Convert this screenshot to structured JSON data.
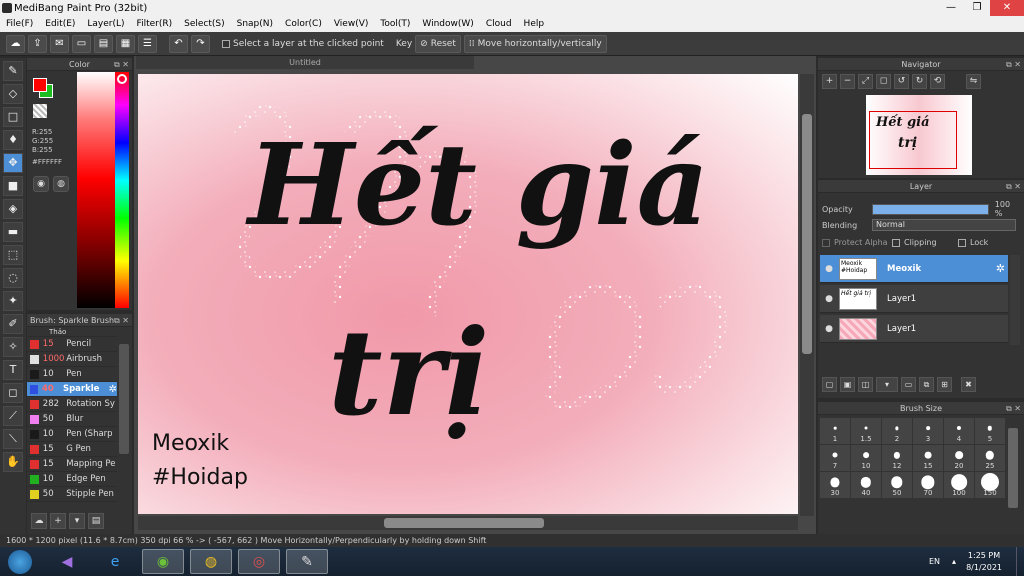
{
  "window": {
    "title": "MediBang Paint Pro (32bit)",
    "controls": [
      "—",
      "❐",
      "✕"
    ]
  },
  "menu": [
    "File(F)",
    "Edit(E)",
    "Layer(L)",
    "Filter(R)",
    "Select(S)",
    "Snap(N)",
    "Color(C)",
    "View(V)",
    "Tool(T)",
    "Window(W)",
    "Cloud",
    "Help"
  ],
  "toolbar": {
    "select_layer_label": "Select a layer at the clicked point",
    "key_label": "Key",
    "reset_label": "Reset",
    "move_label": "Move horizontally/vertically"
  },
  "color_panel": {
    "title": "Color",
    "r": "R:255",
    "g": "G:255",
    "b": "B:255",
    "hex": "#FFFFFF"
  },
  "brush_panel": {
    "title": "Brush: Sparkle Brush",
    "partial_top": "Thảo",
    "items": [
      {
        "size": "15",
        "name": "Pencil",
        "color": "#e03030",
        "red_size": true
      },
      {
        "size": "1000",
        "name": "Airbrush",
        "color": "#e0e0e0",
        "red_size": true
      },
      {
        "size": "10",
        "name": "Pen",
        "color": "#1a1a1a",
        "red_size": false
      },
      {
        "size": "40",
        "name": "Sparkle",
        "color": "#2f4fe0",
        "red_size": true,
        "selected": true
      },
      {
        "size": "282",
        "name": "Rotation Sy",
        "color": "#e03030",
        "red_size": false
      },
      {
        "size": "50",
        "name": "Blur",
        "color": "#f080f0",
        "red_size": false
      },
      {
        "size": "10",
        "name": "Pen (Sharp",
        "color": "#1a1a1a",
        "red_size": false
      },
      {
        "size": "15",
        "name": "G Pen",
        "color": "#e03030",
        "red_size": false
      },
      {
        "size": "15",
        "name": "Mapping Pe",
        "color": "#e03030",
        "red_size": false
      },
      {
        "size": "10",
        "name": "Edge Pen",
        "color": "#20b020",
        "red_size": false
      },
      {
        "size": "50",
        "name": "Stipple Pen",
        "color": "#e0d020",
        "red_size": false
      }
    ]
  },
  "canvas": {
    "tab_title": "Untitled",
    "line1": "Hết giá",
    "line2": "trị",
    "credit1": "Meoxik",
    "credit2": "#Hoidap"
  },
  "navigator": {
    "title": "Navigator",
    "thumb_line1": "Hết giá",
    "thumb_line2": "trị"
  },
  "layer_panel": {
    "title": "Layer",
    "opacity_label": "Opacity",
    "opacity_value": "100 %",
    "opacity_fraction": 1.0,
    "blending_label": "Blending",
    "blending_value": "Normal",
    "protect_alpha": "Protect Alpha",
    "clipping": "Clipping",
    "lock": "Lock",
    "layers": [
      {
        "name": "Meoxik",
        "thumb": "Meoxik #Hoidap",
        "selected": true
      },
      {
        "name": "Layer1",
        "thumb": "Hết giá trị",
        "selected": false
      },
      {
        "name": "Layer1",
        "thumb": "",
        "selected": false
      }
    ]
  },
  "brush_size": {
    "title": "Brush Size",
    "sizes": [
      {
        "label": "1",
        "v": 1
      },
      {
        "label": "1.5",
        "v": 1.5
      },
      {
        "label": "2",
        "v": 2
      },
      {
        "label": "3",
        "v": 3
      },
      {
        "label": "4",
        "v": 4
      },
      {
        "label": "5",
        "v": 5
      },
      {
        "label": "7",
        "v": 7
      },
      {
        "label": "10",
        "v": 10
      },
      {
        "label": "12",
        "v": 12
      },
      {
        "label": "15",
        "v": 15
      },
      {
        "label": "20",
        "v": 20
      },
      {
        "label": "25",
        "v": 25
      },
      {
        "label": "30",
        "v": 30
      },
      {
        "label": "40",
        "v": 40
      },
      {
        "label": "50",
        "v": 50
      },
      {
        "label": "70",
        "v": 70
      },
      {
        "label": "100",
        "v": 100
      },
      {
        "label": "150",
        "v": 150
      }
    ]
  },
  "status": "1600 * 1200 pixel   (11.6 * 8.7cm)   350 dpi   66 %   -> ( -567, 662 )   Move Horizontally/Perpendicularly by holding down Shift",
  "taskbar": {
    "lang": "EN",
    "time": "1:25 PM",
    "date": "8/1/2021"
  },
  "colors": {
    "accent": "#4c8fd6",
    "fg_color": "#ff0000",
    "bg_color": "#1ebc1e"
  }
}
